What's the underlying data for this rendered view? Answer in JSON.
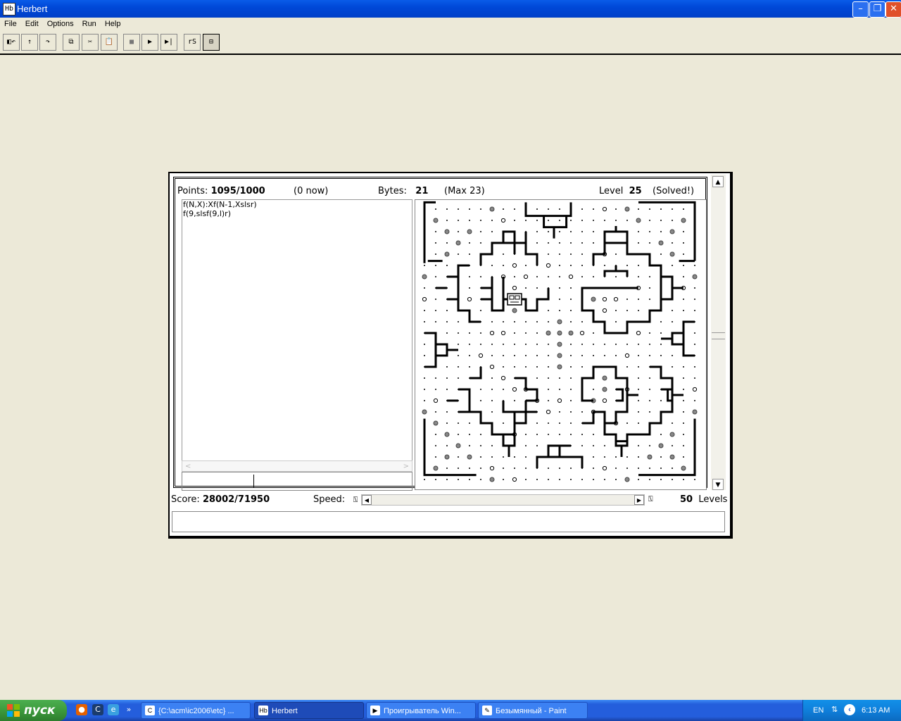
{
  "window": {
    "title": "Herbert",
    "icon_text": "Hb"
  },
  "menu": [
    "File",
    "Edit",
    "Options",
    "Run",
    "Help"
  ],
  "toolbar_glyphs": [
    "◧↶",
    "↑",
    "↷",
    "⧉",
    "✂",
    "📋",
    "■",
    "▶",
    "▶|",
    "rS",
    "⊟"
  ],
  "header": {
    "points_label": "Points:",
    "points_value": "1095/1000",
    "points_now": "(0 now)",
    "bytes_label": "Bytes:",
    "bytes_value": "21",
    "bytes_max": "(Max 23)",
    "level_label": "Level",
    "level_value": "25",
    "level_status": "(Solved!)"
  },
  "code_lines": [
    "f(N,X):Xf(N-1,Xslsr)",
    "f(9,slsf(9,l)r)"
  ],
  "status": {
    "score_label": "Score:",
    "score_value": "28002/71950",
    "speed_label": "Speed:",
    "levels_value": "50",
    "levels_label": "Levels"
  },
  "taskbar": {
    "start_label": "пуск",
    "tasks": [
      "{C:\\acm\\ic2006\\etc} ...",
      "Herbert",
      "Проигрыватель Win...",
      "Безымянный - Paint"
    ],
    "lang": "EN",
    "clock": "6:13 AM"
  },
  "colors": {
    "title_blue": "#0A5CE8",
    "face": "#ECE9D8",
    "taskbar_blue": "#245EDC",
    "start_green": "#3C9A3C"
  }
}
